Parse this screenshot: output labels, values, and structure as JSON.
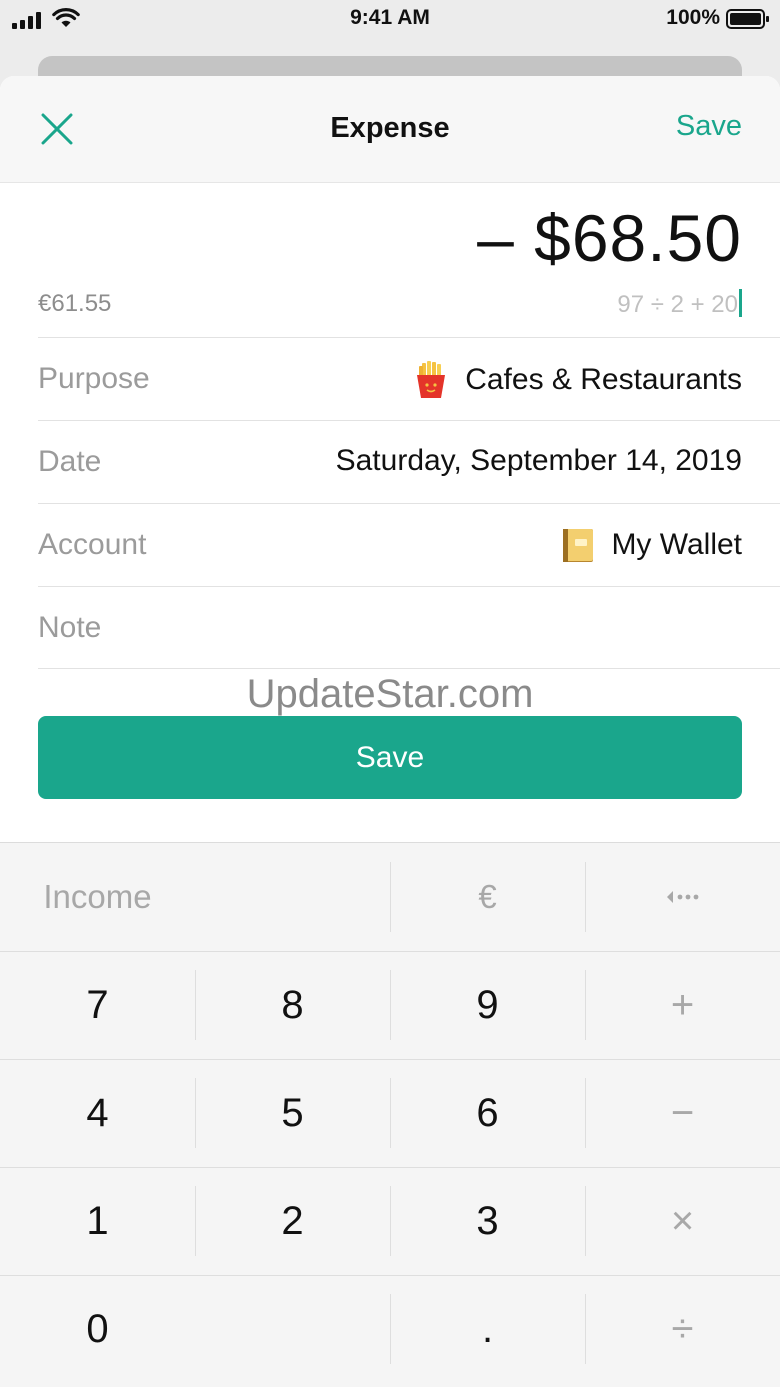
{
  "status_bar": {
    "time": "9:41 AM",
    "battery": "100%"
  },
  "nav": {
    "title": "Expense",
    "save_label": "Save"
  },
  "amount": {
    "display": "– $68.50",
    "converted": "€61.55",
    "expression": "97 ÷ 2 + 20"
  },
  "fields": {
    "purpose": {
      "label": "Purpose",
      "value": "Cafes & Restaurants",
      "icon": "fries-icon"
    },
    "date": {
      "label": "Date",
      "value": "Saturday, September 14, 2019"
    },
    "account": {
      "label": "Account",
      "value": "My Wallet",
      "icon": "ledger-icon"
    },
    "note": {
      "label": "Note",
      "value": ""
    }
  },
  "watermark": "UpdateStar.com",
  "save_button": "Save",
  "keypad": {
    "income": "Income",
    "currency": "€",
    "keys": [
      "7",
      "8",
      "9",
      "4",
      "5",
      "6",
      "1",
      "2",
      "3",
      "0",
      "."
    ],
    "ops": {
      "plus": "+",
      "minus": "−",
      "times": "×",
      "divide": "÷"
    }
  },
  "colors": {
    "accent": "#1aa68c"
  }
}
